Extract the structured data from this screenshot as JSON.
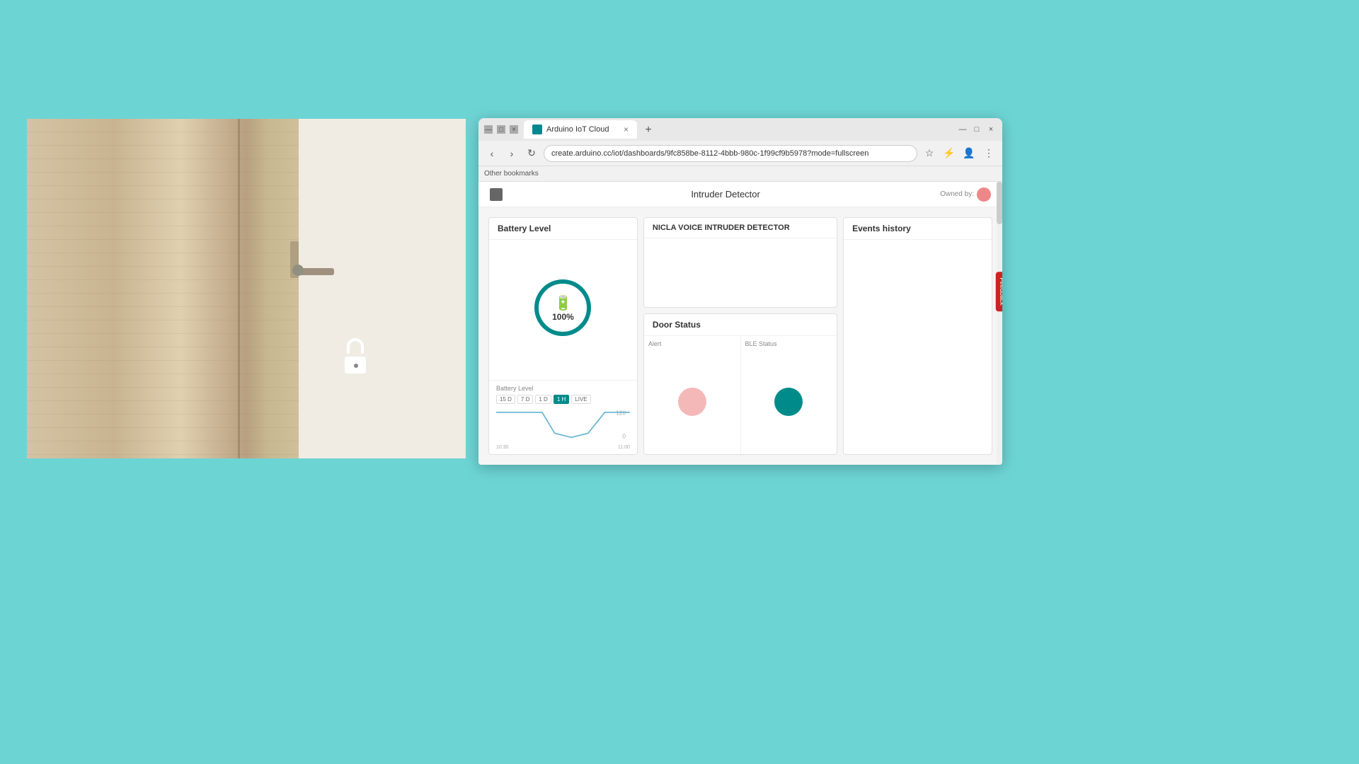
{
  "background_color": "#6dd4d4",
  "photo": {
    "alt": "Wooden door with lock and padlock"
  },
  "browser": {
    "tab": {
      "label": "Arduino IoT Cloud",
      "favicon": "A"
    },
    "url": "create.arduino.cc/iot/dashboards/9fc858be-8112-4bbb-980c-1f99cf9b5978?mode=fullscreen",
    "bookmark_label": "Other bookmarks",
    "window_controls": {
      "minimize": "—",
      "maximize": "□",
      "close": "×"
    }
  },
  "dashboard": {
    "title": "Intruder Detector",
    "owned_by": "Owned by:",
    "widgets": {
      "battery": {
        "title": "Battery Level",
        "percentage": "100%",
        "chart_title": "Battery Level",
        "time_filters": [
          "15 D",
          "7 D",
          "1 D",
          "1 H",
          "LIVE"
        ],
        "active_filter": "1 H",
        "chart_times": [
          "10:30",
          "11:00"
        ]
      },
      "nicla": {
        "title": "NICLA VOICE INTRUDER DETECTOR"
      },
      "door_status": {
        "title": "Door Status",
        "alert_label": "Alert",
        "ble_label": "BLE Status"
      },
      "events": {
        "title": "Events history"
      }
    }
  },
  "feedback": {
    "label": "Feedback"
  }
}
